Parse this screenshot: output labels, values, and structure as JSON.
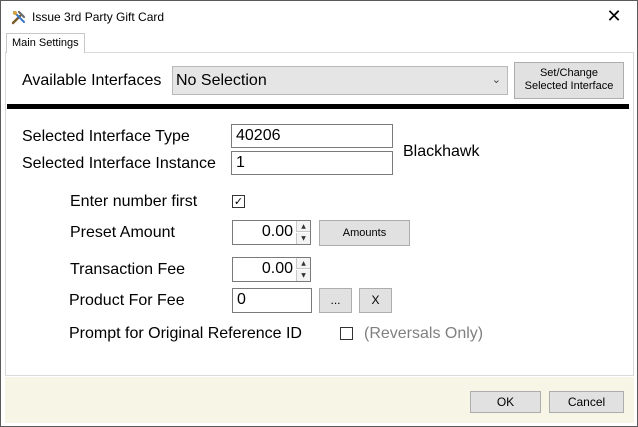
{
  "window": {
    "title": "Issue 3rd Party Gift Card",
    "close_glyph": "✕"
  },
  "tabs": [
    {
      "label": "Main Settings"
    }
  ],
  "interfaces": {
    "label": "Available Interfaces",
    "selected": "No Selection",
    "set_change_button": "Set/Change\nSelected Interface"
  },
  "selected_interface": {
    "type_label": "Selected Interface Type",
    "type_value": "40206",
    "instance_label": "Selected Interface Instance",
    "instance_value": "1",
    "provider_name": "Blackhawk"
  },
  "settings": {
    "enter_number_first_label": "Enter number first",
    "enter_number_first_checked": true,
    "preset_amount_label": "Preset Amount",
    "preset_amount_value": "0.00",
    "amounts_button": "Amounts",
    "transaction_fee_label": "Transaction Fee",
    "transaction_fee_value": "0.00",
    "product_for_fee_label": "Product For Fee",
    "product_for_fee_value": "0",
    "browse_button": "...",
    "clear_button": "X",
    "prompt_original_ref_label": "Prompt for Original Reference ID",
    "prompt_original_ref_checked": false,
    "reversals_only_note": "(Reversals Only)"
  },
  "footer": {
    "ok_button": "OK",
    "cancel_button": "Cancel"
  },
  "colors": {
    "divider": "#000000",
    "footer_bg": "#f7f6e6",
    "button_bg": "#e1e1e1",
    "combo_bg": "#e5e5e5"
  }
}
